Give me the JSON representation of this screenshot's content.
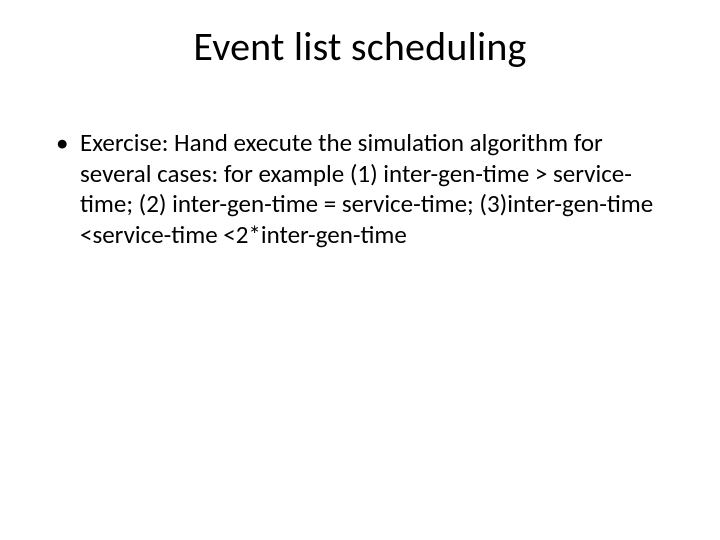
{
  "title": "Event list scheduling",
  "bullets": [
    "Exercise: Hand execute the simulation algorithm for several cases: for example (1) inter-gen-time > service-time; (2) inter-gen-time = service-time; (3)inter-gen-time <service-time <2*inter-gen-time"
  ]
}
